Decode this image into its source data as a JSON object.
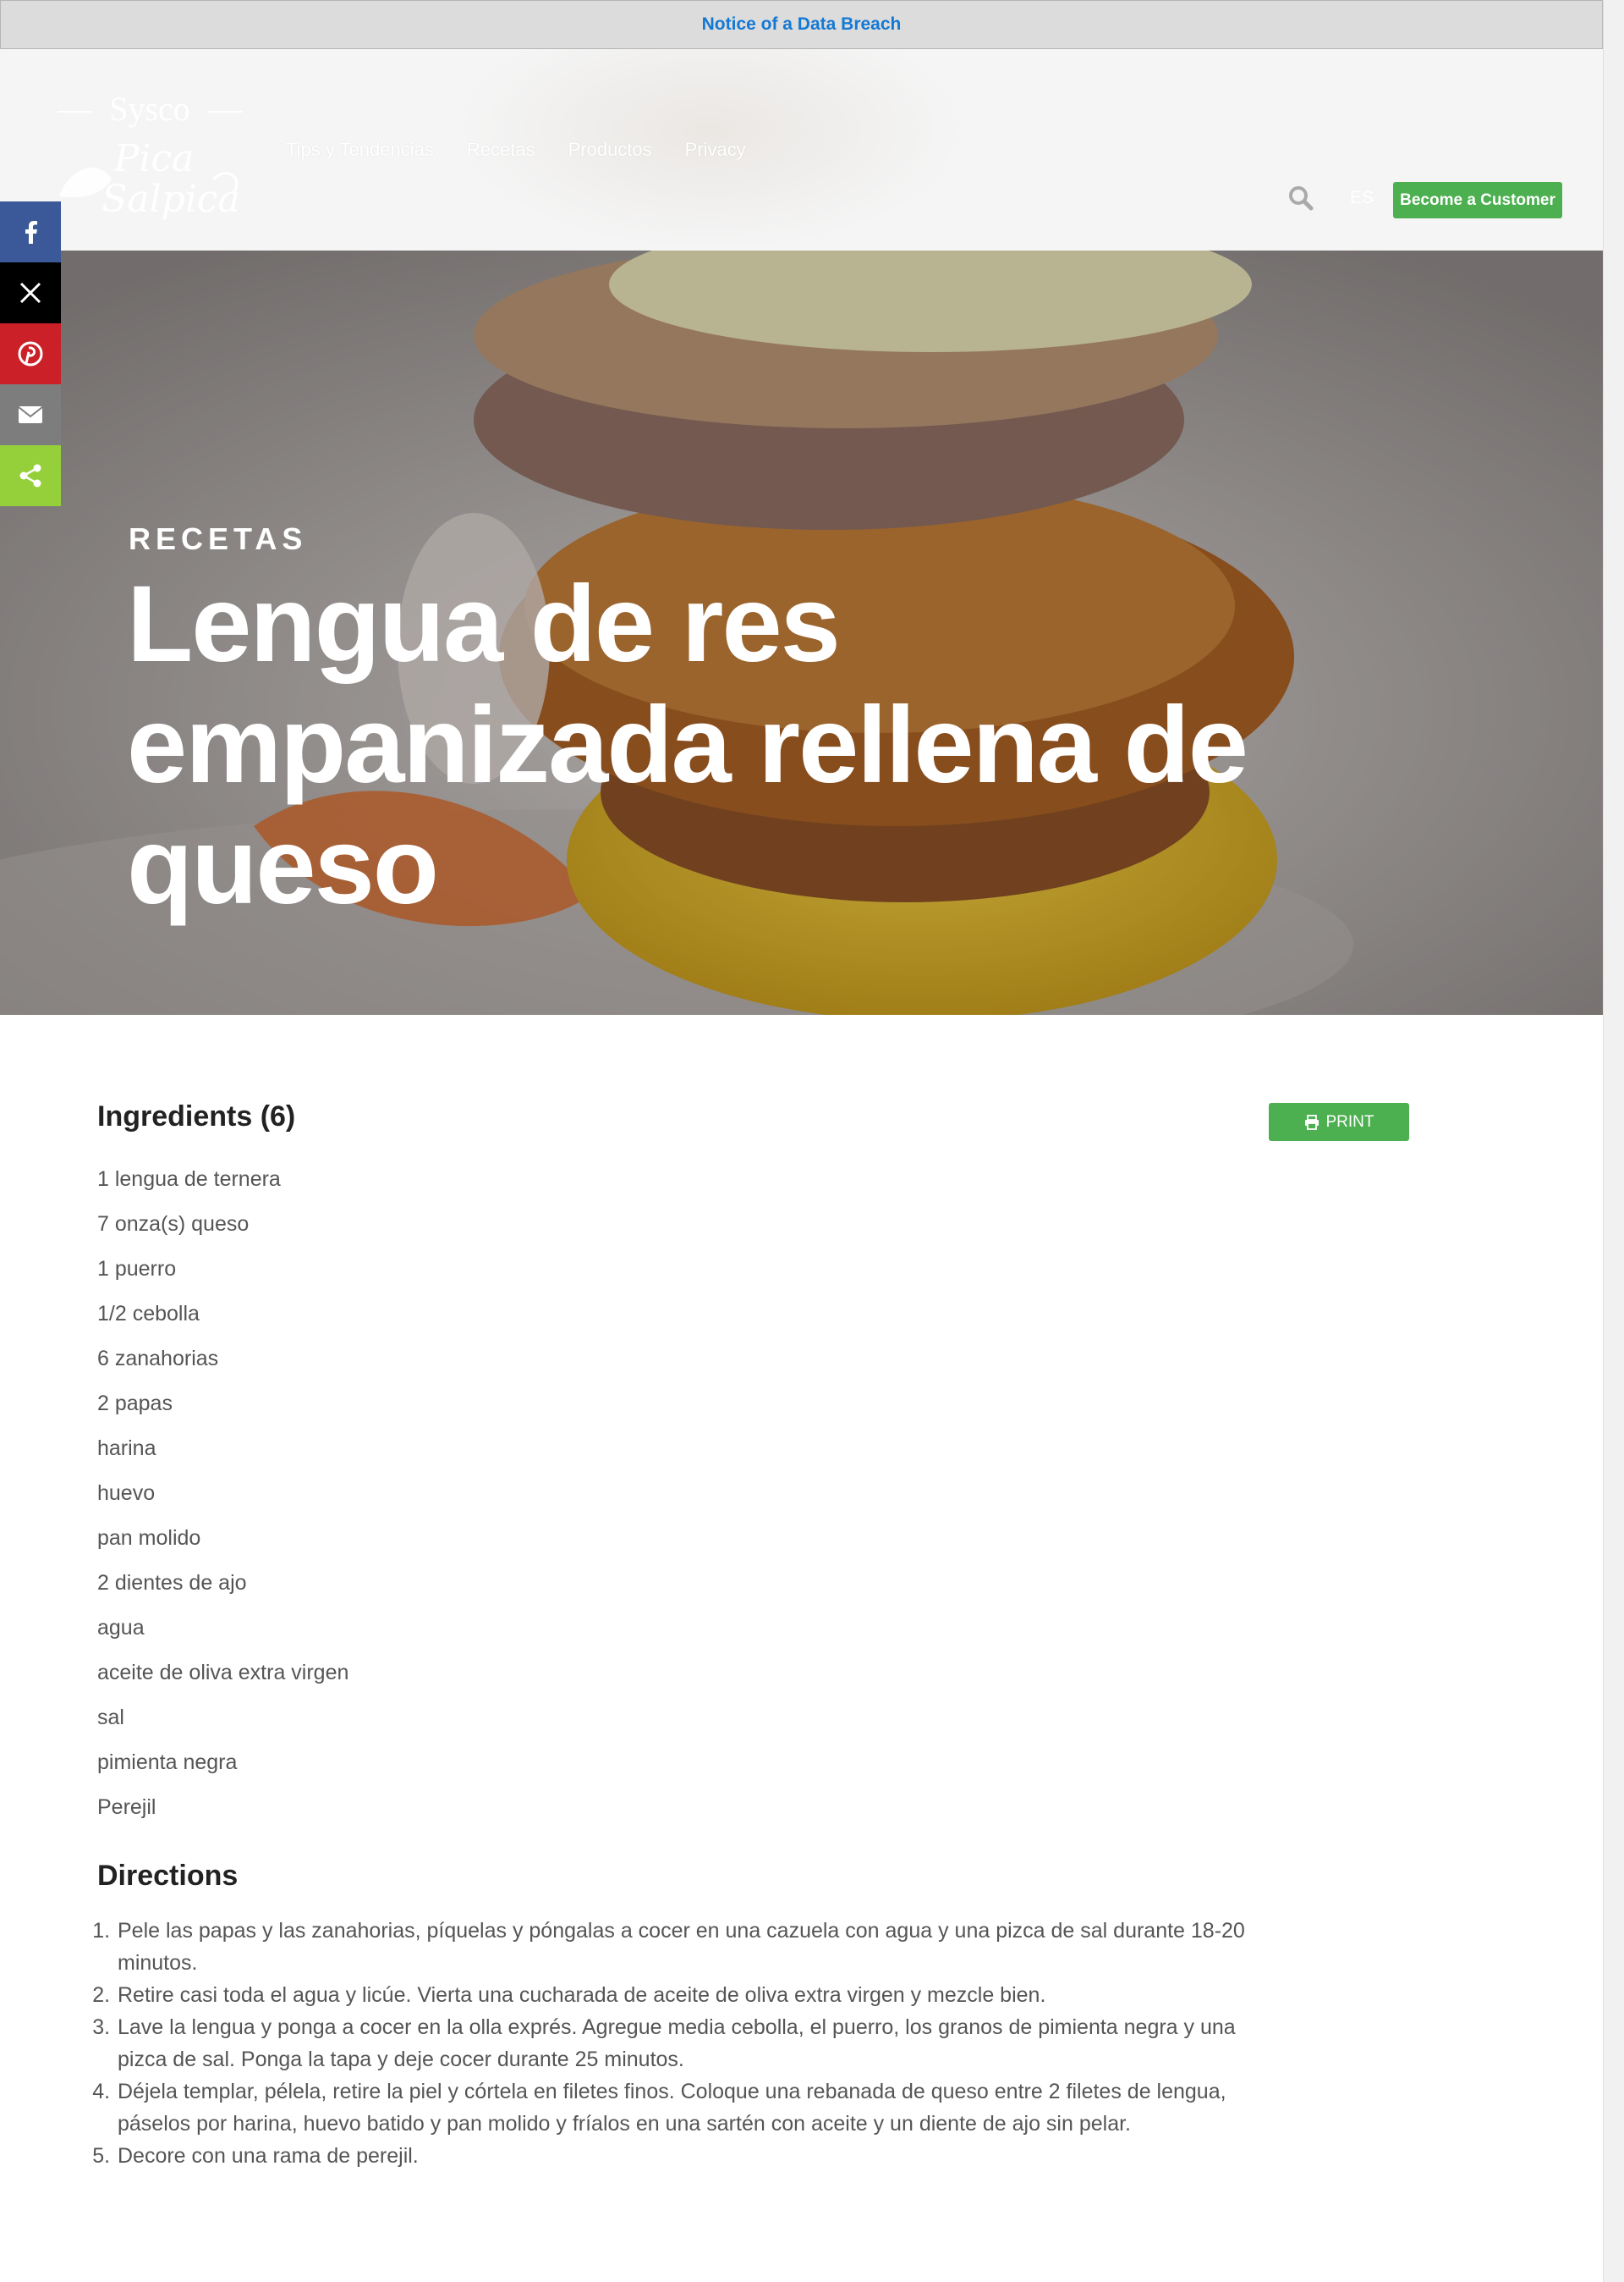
{
  "notice": {
    "label": "Notice of a Data Breach"
  },
  "header": {
    "logo": {
      "brand": "Sysco",
      "script": "Pica y Salpica"
    },
    "nav": [
      "Tips y Tendencias",
      "Recetas",
      "Productos",
      "Privacy"
    ],
    "language": "ES",
    "cta_label": "Become a Customer",
    "search_icon": "search-icon"
  },
  "share": {
    "buttons": [
      {
        "name": "facebook",
        "icon": "facebook-icon",
        "color": "#3b5998"
      },
      {
        "name": "x",
        "icon": "x-icon",
        "color": "#000000"
      },
      {
        "name": "pinterest",
        "icon": "pinterest-icon",
        "color": "#cb2027"
      },
      {
        "name": "email",
        "icon": "email-icon",
        "color": "#7d7d7d"
      },
      {
        "name": "share",
        "icon": "share-icon",
        "color": "#95d03a"
      }
    ]
  },
  "hero": {
    "kicker": "RECETAS",
    "title": "Lengua de res empanizada rellena de queso"
  },
  "ingredients": {
    "title": "Ingredients (6)",
    "print_label": "PRINT",
    "items": [
      "1 lengua de ternera",
      "7 onza(s) queso",
      "1 puerro",
      "1/2 cebolla",
      "6 zanahorias",
      "2 papas",
      "harina",
      "huevo",
      "pan molido",
      "2 dientes de ajo",
      "agua",
      "aceite de oliva extra virgen",
      "sal",
      "pimienta negra",
      "Perejil"
    ]
  },
  "directions": {
    "title": "Directions",
    "steps": [
      "Pele las papas y las zanahorias, píquelas y póngalas a cocer en una cazuela con agua y una pizca de sal durante 18-20 minutos.",
      "Retire casi toda el agua y licúe. Vierta una cucharada de aceite de oliva extra virgen y mezcle bien.",
      "Lave la lengua y ponga a cocer en la olla exprés. Agregue media cebolla, el puerro, los granos de pimienta negra y una pizca de sal. Ponga la tapa y deje cocer durante 25 minutos.",
      "Déjela templar, pélela, retire la piel y córtela en filetes finos. Coloque una rebanada de queso entre 2 filetes de lengua, páselos por harina, huevo batido y pan molido y fríalos en una sartén con aceite y un diente de ajo sin pelar.",
      "Decore con una rama de perejil."
    ]
  }
}
